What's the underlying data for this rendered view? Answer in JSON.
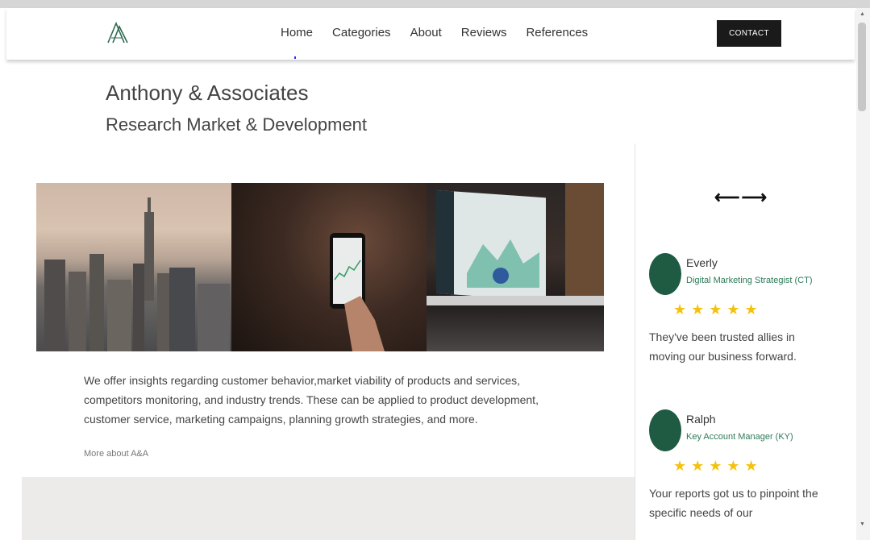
{
  "nav": {
    "items": [
      "Home",
      "Categories",
      "About",
      "Reviews",
      "References"
    ],
    "contact_label": "CONTACT"
  },
  "brand": {
    "title": "Anthony & Associates",
    "subtitle": "Research Market & Development"
  },
  "hero": {
    "images": [
      "city-skyline-image",
      "smartphone-chart-image",
      "laptop-dashboard-image"
    ]
  },
  "about": {
    "text": "We offer insights regarding customer behavior,market viability of products and services, competitors monitoring, and industry trends. These can be applied to product development, customer service, marketing campaigns, planning growth strategies, and more.",
    "more_link": "More about A&A"
  },
  "reviews": {
    "arrows": "⟵⟶",
    "items": [
      {
        "name": "Everly",
        "role": "Digital Marketing Strategist (CT)",
        "stars": "★★★★★",
        "rating": 5,
        "text": "They've been trusted allies in moving our business forward."
      },
      {
        "name": "Ralph",
        "role": "Key Account Manager (KY)",
        "stars": "★★★★★",
        "rating": 5,
        "text": "Your reports got us to pinpoint the specific needs of our"
      }
    ]
  },
  "colors": {
    "accent_green": "#1f5a43",
    "star_yellow": "#f4c20d",
    "contact_bg": "#1a1a1a"
  }
}
